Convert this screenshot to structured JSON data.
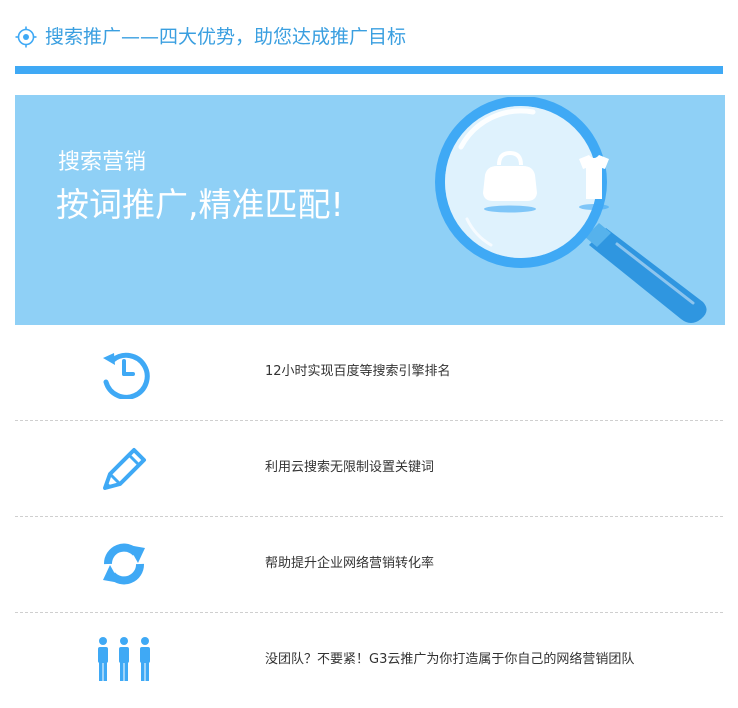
{
  "header": {
    "title": "搜索推广——四大优势，助您达成推广目标",
    "icon": "target-icon"
  },
  "banner": {
    "subtitle": "搜索营销",
    "headline": "按词推广,精准匹配!",
    "illustration": "magnifier-icon"
  },
  "features": [
    {
      "icon": "clock-icon",
      "text": "12小时实现百度等搜索引擎排名"
    },
    {
      "icon": "pencil-icon",
      "text": "利用云搜索无限制设置关键词"
    },
    {
      "icon": "refresh-icon",
      "text": "帮助提升企业网络营销转化率"
    },
    {
      "icon": "team-icon",
      "text": "没团队？不要紧！G3云推广为你打造属于你自己的网络营销团队"
    }
  ],
  "colors": {
    "accent": "#3fa9f5",
    "banner_bg": "#8fd0f6",
    "title_text": "#3a9fe0",
    "body_text": "#333333",
    "divider": "#cfcfcf"
  }
}
